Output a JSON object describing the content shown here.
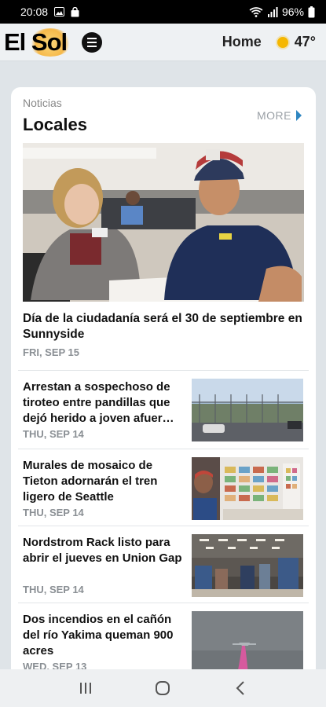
{
  "status_bar": {
    "time": "20:08",
    "battery": "96%"
  },
  "header": {
    "logo_text": "El Sol",
    "home_label": "Home",
    "temperature": "47°"
  },
  "section": {
    "kicker": "Noticias",
    "title": "Locales",
    "more_label": "MORE"
  },
  "featured": {
    "title": "Día de la ciudadanía será el 30 de septiembre en Sunnyside",
    "date": "FRI, SEP 15"
  },
  "stories": [
    {
      "title": "Arrestan a sospechoso de tiroteo entre pandillas que dejó herido a joven afuer…",
      "date": "THU, SEP 14"
    },
    {
      "title": "Murales de mosaico de Tieton adornarán el tren ligero de Seattle",
      "date": "THU, SEP 14"
    },
    {
      "title": "Nordstrom Rack listo para abrir el jueves en Union Gap",
      "date": "THU, SEP 14"
    },
    {
      "title": "Dos incendios en el cañón del río Yakima queman 900 acres",
      "date": "WED, SEP 13"
    }
  ],
  "colors": {
    "accent": "#2e86c1",
    "sun": "#f5b700"
  }
}
